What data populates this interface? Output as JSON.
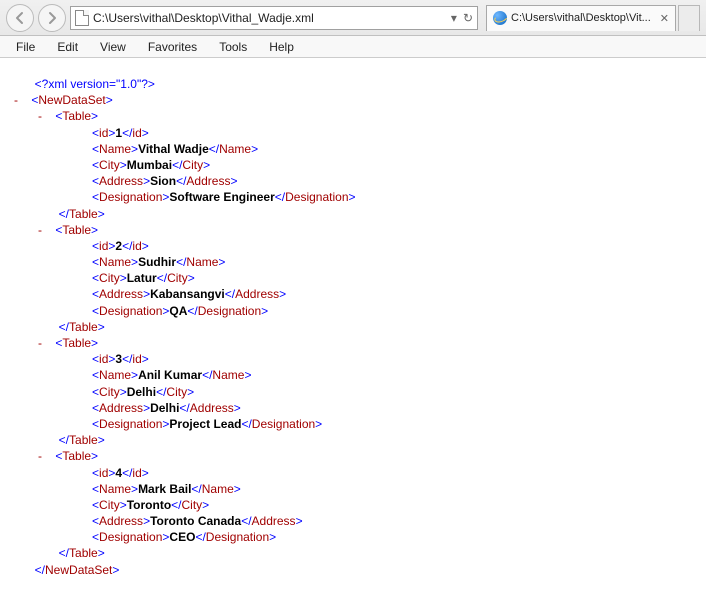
{
  "nav": {
    "back_tooltip": "Back",
    "forward_tooltip": "Forward"
  },
  "address": {
    "url": "C:\\Users\\vithal\\Desktop\\Vithal_Wadje.xml",
    "dropdown": "▾",
    "refresh": "↻",
    "stop": "✕"
  },
  "tab": {
    "title": "C:\\Users\\vithal\\Desktop\\Vit...",
    "close": "✕"
  },
  "menu": {
    "file": "File",
    "edit": "Edit",
    "view": "View",
    "favorites": "Favorites",
    "tools": "Tools",
    "help": "Help"
  },
  "xml": {
    "declaration": "<?xml version=\"1.0\"?>",
    "root_name": "NewDataSet",
    "dash": "-",
    "table_name": "Table",
    "fields": {
      "id": "id",
      "name": "Name",
      "city": "City",
      "address": "Address",
      "designation": "Designation"
    },
    "records": [
      {
        "id": "1",
        "name": "Vithal Wadje",
        "city": "Mumbai",
        "address": "Sion",
        "designation": "Software Engineer"
      },
      {
        "id": "2",
        "name": "Sudhir",
        "city": "Latur",
        "address": "Kabansangvi",
        "designation": "QA"
      },
      {
        "id": "3",
        "name": "Anil Kumar",
        "city": "Delhi",
        "address": "Delhi",
        "designation": "Project Lead"
      },
      {
        "id": "4",
        "name": "Mark Bail",
        "city": "Toronto",
        "address": "Toronto Canada",
        "designation": "CEO"
      }
    ]
  }
}
